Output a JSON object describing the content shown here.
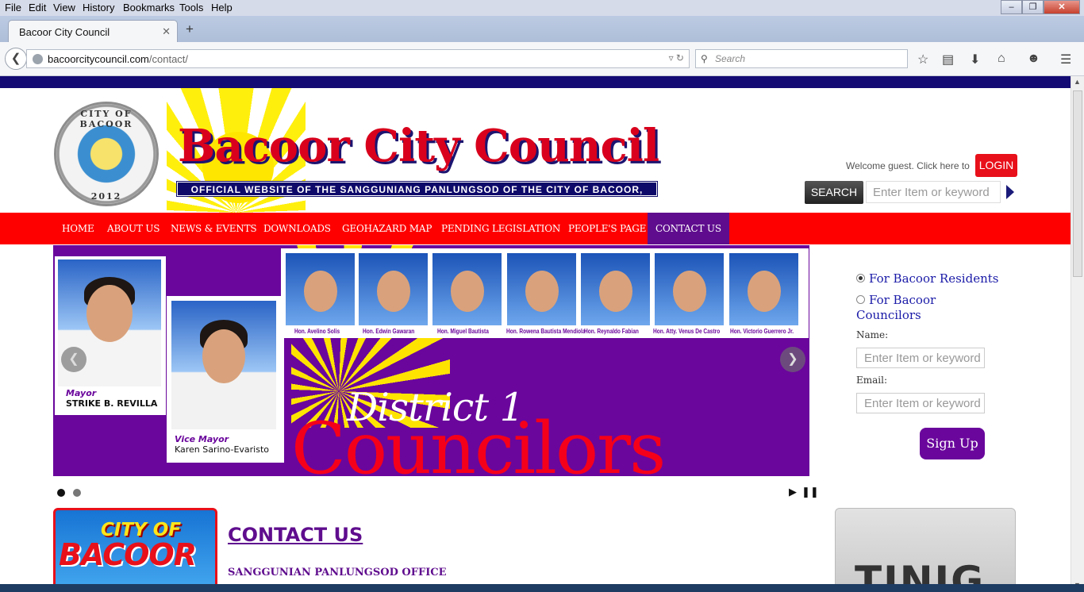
{
  "menubar": {
    "items": [
      "File",
      "Edit",
      "View",
      "History",
      "Bookmarks",
      "Tools",
      "Help"
    ]
  },
  "browser": {
    "tab_title": "Bacoor City Council",
    "url_host": "bacoorcitycouncil.com",
    "url_path": "/contact/",
    "search_placeholder": "Search"
  },
  "header": {
    "seal_top": "CITY OF BACOOR",
    "seal_year": "2012",
    "title": "Bacoor City Council",
    "subtitle": "OFFICIAL WEBSITE OF THE SANGGUNIANG PANLUNGSOD OF THE CITY OF BACOOR, CAVITE",
    "welcome": "Welcome guest. Click here to",
    "login_label": "LOGIN",
    "search_label": "SEARCH",
    "search_placeholder": "Enter Item or keyword"
  },
  "nav": {
    "items": [
      "HOME",
      "ABOUT US",
      "NEWS & EVENTS",
      "DOWNLOADS",
      "GEOHAZARD MAP",
      "PENDING LEGISLATION",
      "PEOPLE'S PAGE",
      "CONTACT US"
    ],
    "active": "CONTACT US"
  },
  "slider": {
    "mayor_role": "Mayor",
    "mayor_name": "STRIKE B. REVILLA",
    "vmayor_role": "Vice Mayor",
    "vmayor_name": "Karen Sarino-Evaristo",
    "councilors": [
      "Hon. Avelino Solis",
      "Hon. Edwin Gawaran",
      "Hon. Miguel Bautista",
      "Hon. Rowena Bautista Mendiola",
      "Hon. Reynaldo Fabian",
      "Hon. Atty. Venus De Castro",
      "Hon. Victorio Guerrero Jr."
    ],
    "district": "District 1",
    "councilors_word": "Councilors"
  },
  "sidebar": {
    "option_residents": "For Bacoor Residents",
    "option_councilors": "For Bacoor Councilors",
    "name_label": "Name:",
    "email_label": "Email:",
    "input_placeholder": "Enter Item or keyword",
    "signup_label": "Sign Up"
  },
  "content": {
    "heading": "CONTACT US",
    "office": "SANGGUNIAN PANLUNGSOD OFFICE",
    "promo_city": "CITY OF",
    "promo_bacoor": "BACOOR",
    "ad_text": "TINIG"
  },
  "colors": {
    "nav": "#fe0000",
    "purple": "#6a069c",
    "topline": "#140b74"
  }
}
